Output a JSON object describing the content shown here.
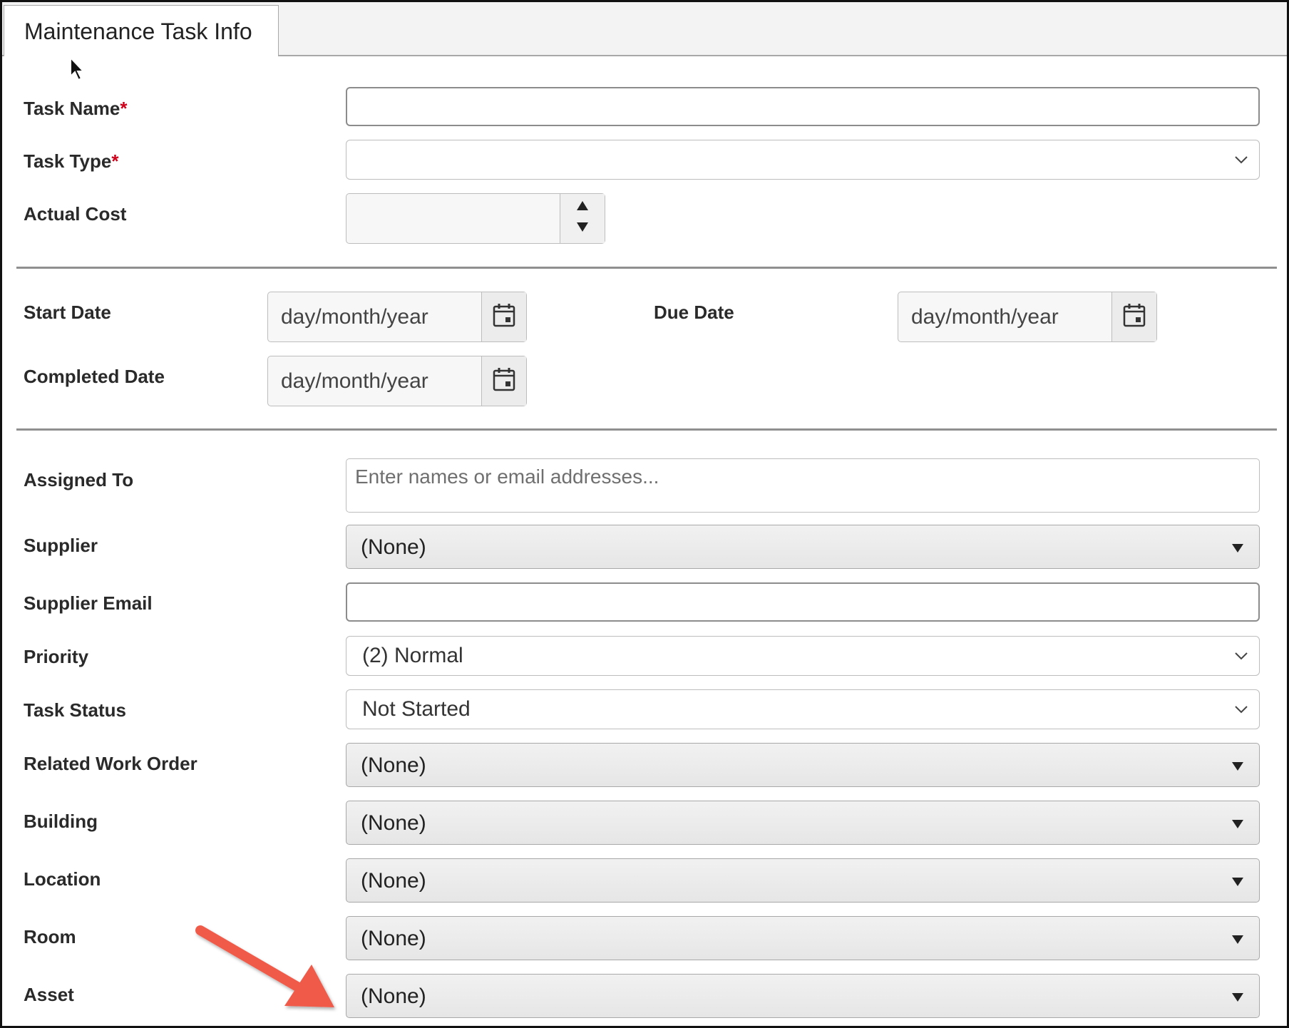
{
  "tab": {
    "title": "Maintenance Task Info"
  },
  "fields": {
    "task_name": {
      "label": "Task Name",
      "required_mark": "*",
      "value": ""
    },
    "task_type": {
      "label": "Task Type",
      "required_mark": "*",
      "value": ""
    },
    "actual_cost": {
      "label": "Actual Cost",
      "value": ""
    },
    "start_date": {
      "label": "Start Date",
      "placeholder": "day/month/year"
    },
    "due_date": {
      "label": "Due Date",
      "placeholder": "day/month/year"
    },
    "completed_date": {
      "label": "Completed Date",
      "placeholder": "day/month/year"
    },
    "assigned_to": {
      "label": "Assigned To",
      "placeholder": "Enter names or email addresses..."
    },
    "supplier": {
      "label": "Supplier",
      "value": "(None)"
    },
    "supplier_email": {
      "label": "Supplier Email",
      "value": ""
    },
    "priority": {
      "label": "Priority",
      "value": "(2) Normal"
    },
    "task_status": {
      "label": "Task Status",
      "value": "Not Started"
    },
    "related_work_order": {
      "label": "Related Work Order",
      "value": "(None)"
    },
    "building": {
      "label": "Building",
      "value": "(None)"
    },
    "location": {
      "label": "Location",
      "value": "(None)"
    },
    "room": {
      "label": "Room",
      "value": "(None)"
    },
    "asset": {
      "label": "Asset",
      "value": "(None)"
    }
  },
  "colors": {
    "required": "#d0021b",
    "annotation_arrow": "#f05a4a"
  },
  "icons": [
    "calendar-icon",
    "chevron-down-icon",
    "triangle-down-icon",
    "spinner-up-icon",
    "spinner-down-icon",
    "mouse-cursor-icon",
    "annotation-arrow-icon"
  ]
}
